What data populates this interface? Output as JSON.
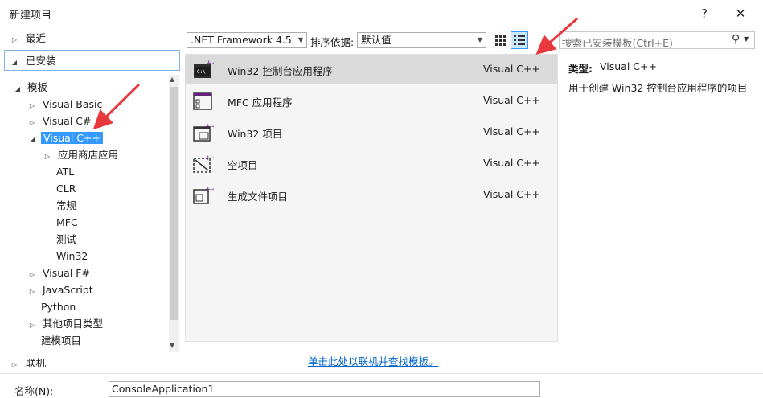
{
  "dialog": {
    "title": "新建项目",
    "help_label": "?",
    "close_label": "✕"
  },
  "tree": {
    "recent": "最近",
    "installed": "已安装",
    "templates": "模板",
    "visual_basic": "Visual Basic",
    "visual_csharp": "Visual C#",
    "visual_cpp": "Visual C++",
    "store_apps": "应用商店应用",
    "atl": "ATL",
    "clr": "CLR",
    "general": "常规",
    "mfc": "MFC",
    "test": "测试",
    "win32": "Win32",
    "visual_fsharp": "Visual F#",
    "javascript": "JavaScript",
    "python": "Python",
    "other_types": "其他项目类型",
    "modeling": "建模项目",
    "online": "联机"
  },
  "toolbar": {
    "framework": ".NET Framework 4.5",
    "sort_label": "排序依据:",
    "sort_value": "默认值",
    "search_placeholder": "搜索已安装模板(Ctrl+E)"
  },
  "templates": [
    {
      "name": "Win32 控制台应用程序",
      "lang": "Visual C++"
    },
    {
      "name": "MFC 应用程序",
      "lang": "Visual C++"
    },
    {
      "name": "Win32 项目",
      "lang": "Visual C++"
    },
    {
      "name": "空项目",
      "lang": "Visual C++"
    },
    {
      "name": "生成文件项目",
      "lang": "Visual C++"
    }
  ],
  "details": {
    "type_label": "类型:",
    "type_value": "Visual C++",
    "description": "用于创建 Win32 控制台应用程序的项目"
  },
  "online_link": "单击此处以联机并查找模板。",
  "name_field": {
    "label": "名称(N):",
    "value": "ConsoleApplication1"
  },
  "colors": {
    "selection": "#3399ff",
    "arrow": "#e8383d",
    "link": "#0066cc"
  }
}
